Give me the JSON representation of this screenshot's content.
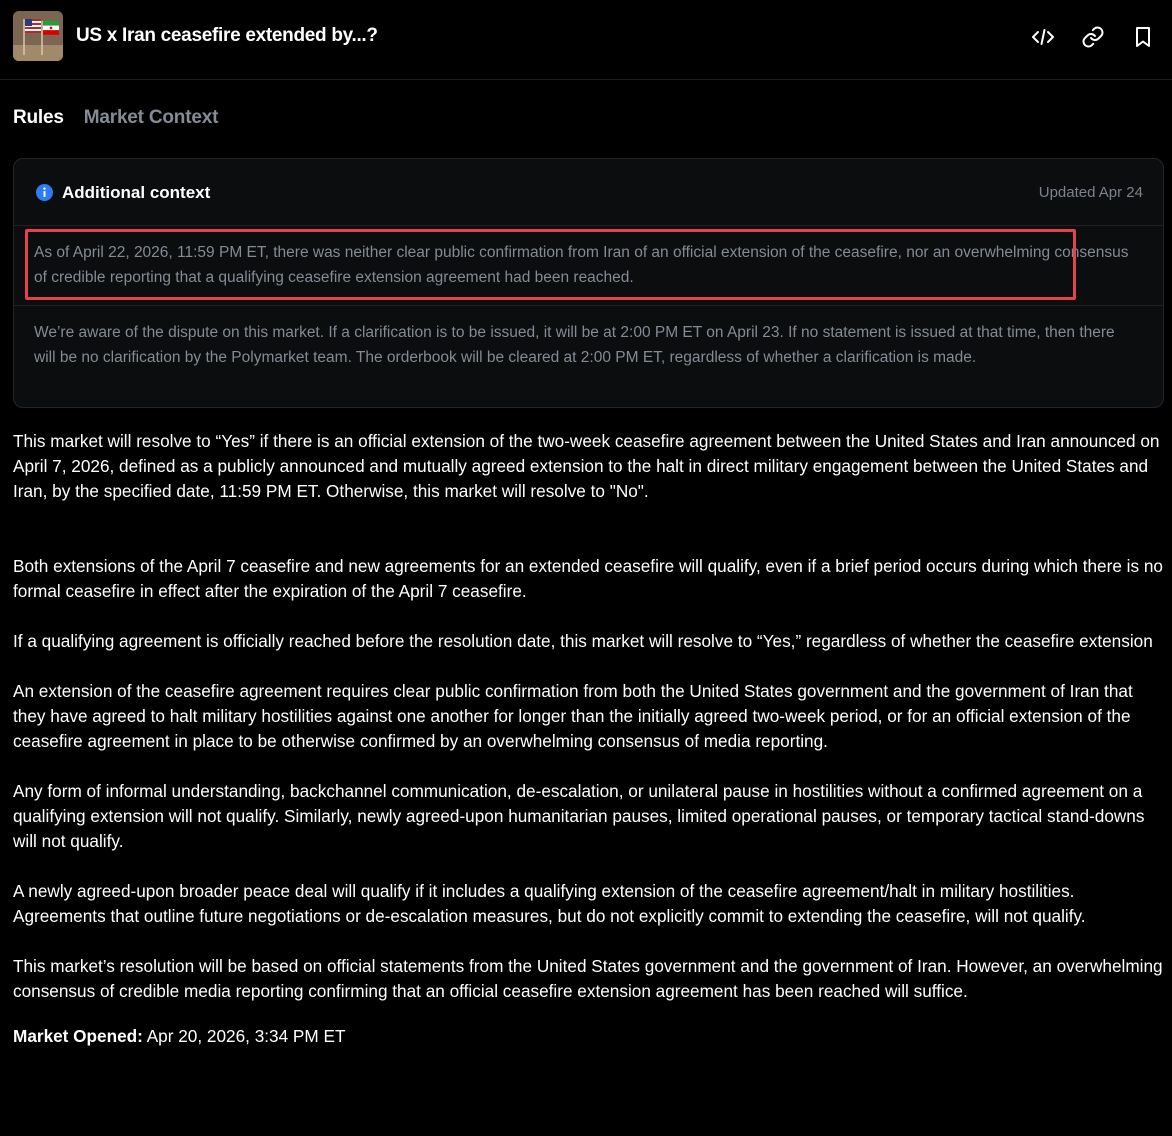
{
  "header": {
    "title": "US x Iran ceasefire extended by...?",
    "thumbnail": "us-iran-flags-image",
    "icons": [
      "embed-code-icon",
      "link-icon",
      "bookmark-icon"
    ]
  },
  "tabs": [
    {
      "label": "Rules",
      "active": true
    },
    {
      "label": "Market Context",
      "active": false
    }
  ],
  "context": {
    "title": "Additional context",
    "updated": "Updated Apr 24",
    "paragraph1": "As of April 22, 2026, 11:59 PM ET, there was neither clear public confirmation from Iran of an official extension of the ceasefire, nor an overwhelming consensus of credible reporting that a qualifying ceasefire extension agreement had been reached.",
    "paragraph2": "We’re aware of the dispute on this market. If a clarification is to be issued, it will be at 2:00 PM ET on April 23. If no statement is issued at that time, then there will be no clarification by the Polymarket team. The orderbook will be cleared at 2:00 PM ET, regardless of whether a clarification is made.",
    "highlight_color": "#e5424d",
    "info_color": "#2d7cf6"
  },
  "rules": {
    "p1": "This market will resolve to “Yes” if there is an official extension of the two-week ceasefire agreement between the United States and Iran announced on April 7, 2026, defined as a publicly announced and mutually agreed extension to the halt in direct military engagement between the United States and Iran, by the specified date, 11:59 PM ET. Otherwise, this market will resolve to \"No\".",
    "p2": "Both extensions of the April 7 ceasefire and new agreements for an extended ceasefire will qualify, even if a brief period occurs during which there is no formal ceasefire in effect after the expiration of the April 7 ceasefire.",
    "p3": "If a qualifying agreement is officially reached before the resolution date, this market will resolve to “Yes,” regardless of whether the ceasefire extension ultimately takes effect.",
    "p4": "An extension of the ceasefire agreement requires clear public confirmation from both the United States government and the government of Iran that they have agreed to halt military hostilities against one another for longer than the initially agreed two-week period, or for an official extension of the ceasefire agreement in place to be otherwise confirmed by an overwhelming consensus of media reporting.",
    "p5": "Any form of informal understanding, backchannel communication, de-escalation, or unilateral pause in hostilities without a confirmed agreement on a qualifying extension will not qualify. Similarly, newly agreed-upon humanitarian pauses, limited operational pauses, or temporary tactical stand-downs will not qualify.",
    "p6": "A newly agreed-upon broader peace deal will qualify if it includes a qualifying extension of the ceasefire agreement/halt in military hostilities. Agreements that outline future negotiations or de-escalation measures, but do not explicitly commit to extending the ceasefire, will not qualify.",
    "p7": "This market’s resolution will be based on official statements from the United States government and the government of Iran. However, an overwhelming consensus of credible media reporting confirming that an official ceasefire extension agreement has been reached will suffice.",
    "opened_label": "Market Opened:",
    "opened_value": "Apr 20, 2026, 3:34 PM ET"
  }
}
